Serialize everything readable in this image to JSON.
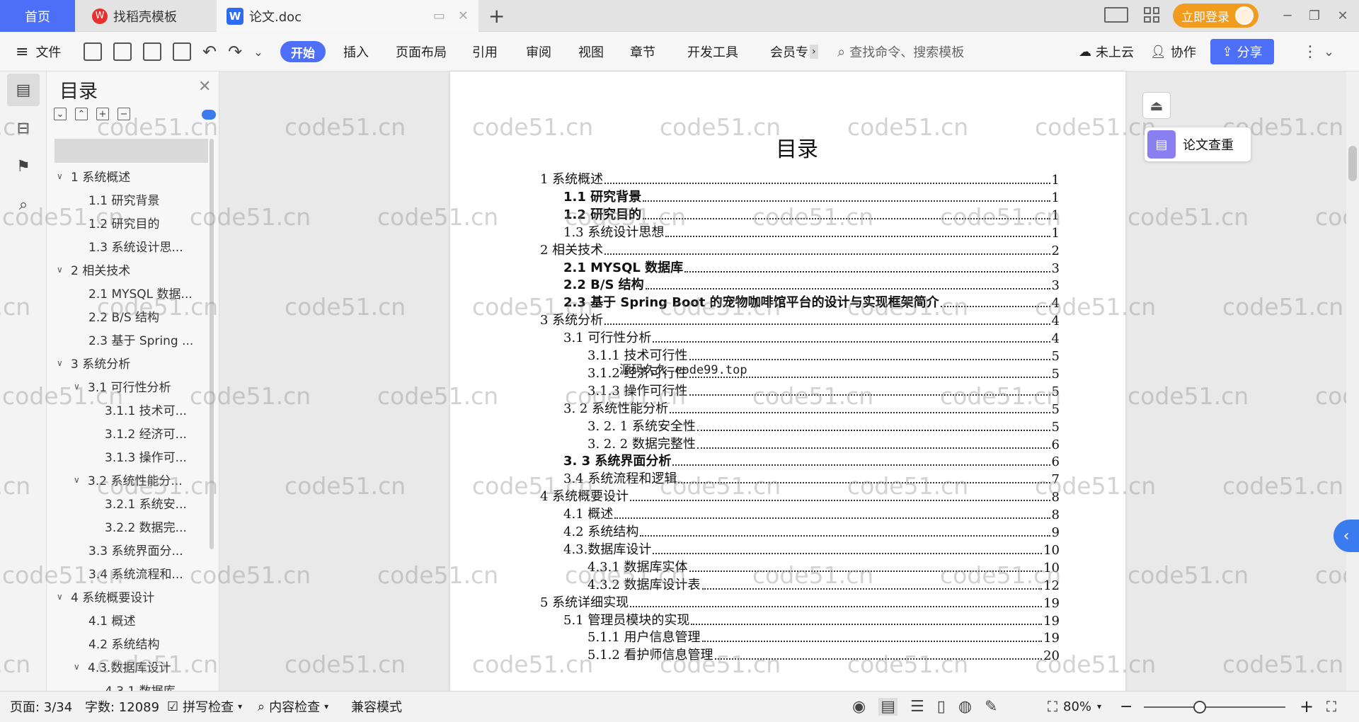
{
  "tabs": {
    "home": "首页",
    "template": "找稻壳模板",
    "doc": "论文.doc",
    "new_tab": "+"
  },
  "header": {
    "login": "立即登录"
  },
  "toolbar": {
    "file": "文件",
    "start": "开始",
    "items": [
      "插入",
      "页面布局",
      "引用",
      "审阅",
      "视图",
      "章节",
      "开发工具",
      "会员专"
    ],
    "search_placeholder": "查找命令、搜索模板",
    "cloud": "未上云",
    "collab": "协作",
    "share": "分享"
  },
  "toc_panel": {
    "title": "目录",
    "items": [
      {
        "label": "1 系统概述",
        "level": 1,
        "expand": true
      },
      {
        "label": "1.1 研究背景",
        "level": 2,
        "expand": false
      },
      {
        "label": "1.2 研究目的",
        "level": 2,
        "expand": false
      },
      {
        "label": "1.3 系统设计思...",
        "level": 2,
        "expand": false
      },
      {
        "label": "2 相关技术",
        "level": 1,
        "expand": true
      },
      {
        "label": "2.1 MYSQL 数据...",
        "level": 2,
        "expand": false
      },
      {
        "label": "2.2 B/S 结构",
        "level": 2,
        "expand": false
      },
      {
        "label": "2.3  基于 Spring ...",
        "level": 2,
        "expand": false
      },
      {
        "label": "3 系统分析",
        "level": 1,
        "expand": true
      },
      {
        "label": "3.1 可行性分析",
        "level": 2,
        "expand": true
      },
      {
        "label": "3.1.1 技术可...",
        "level": 3,
        "expand": false
      },
      {
        "label": "3.1.2 经济可...",
        "level": 3,
        "expand": false
      },
      {
        "label": "3.1.3 操作可...",
        "level": 3,
        "expand": false
      },
      {
        "label": "3.2 系统性能分...",
        "level": 2,
        "expand": true
      },
      {
        "label": "3.2.1  系统安...",
        "level": 3,
        "expand": false
      },
      {
        "label": "3.2.2  数据完...",
        "level": 3,
        "expand": false
      },
      {
        "label": "3.3 系统界面分...",
        "level": 2,
        "expand": false
      },
      {
        "label": "3.4 系统流程和...",
        "level": 2,
        "expand": false
      },
      {
        "label": "4 系统概要设计",
        "level": 1,
        "expand": true
      },
      {
        "label": "4.1 概述",
        "level": 2,
        "expand": false
      },
      {
        "label": "4.2 系统结构",
        "level": 2,
        "expand": false
      },
      {
        "label": "4.3.数据库设计",
        "level": 2,
        "expand": true
      },
      {
        "label": "4.3.1 数据库...",
        "level": 3,
        "expand": false
      }
    ]
  },
  "document": {
    "heading": "目录",
    "entries": [
      {
        "text": "1 系统概述",
        "page": "1",
        "indent": 0,
        "bold": false
      },
      {
        "text": "1.1  研究背景",
        "page": "1",
        "indent": 1,
        "bold": true
      },
      {
        "text": "1.2 研究目的",
        "page": "1",
        "indent": 1,
        "bold": true
      },
      {
        "text": "1.3 系统设计思想",
        "page": "1",
        "indent": 1,
        "bold": false
      },
      {
        "text": "2 相关技术",
        "page": "2",
        "indent": 0,
        "bold": false
      },
      {
        "text": "2.1 MYSQL 数据库",
        "page": "3",
        "indent": 1,
        "bold": true
      },
      {
        "text": "2.2 B/S 结构",
        "page": "3",
        "indent": 1,
        "bold": true
      },
      {
        "text": "2.3  基于 Spring Boot 的宠物咖啡馆平台的设计与实现框架简介",
        "page": "4",
        "indent": 1,
        "bold": true
      },
      {
        "text": "3 系统分析",
        "page": "4",
        "indent": 0,
        "bold": false
      },
      {
        "text": "3.1 可行性分析",
        "page": "4",
        "indent": 1,
        "bold": false
      },
      {
        "text": "3.1.1 技术可行性",
        "page": "5",
        "indent": 2,
        "bold": false
      },
      {
        "text": "3.1.2 经济可行性",
        "page": "5",
        "indent": 2,
        "bold": false
      },
      {
        "text": "3.1.3 操作可行性",
        "page": "5",
        "indent": 2,
        "bold": false
      },
      {
        "text": "3. 2 系统性能分析",
        "page": "5",
        "indent": 1,
        "bold": false
      },
      {
        "text": "3. 2. 1  系统安全性",
        "page": "5",
        "indent": 2,
        "bold": false
      },
      {
        "text": "3. 2. 2  数据完整性",
        "page": "6",
        "indent": 2,
        "bold": false
      },
      {
        "text": "3. 3 系统界面分析",
        "page": "6",
        "indent": 1,
        "bold": true
      },
      {
        "text": "3.4 系统流程和逻辑",
        "page": "7",
        "indent": 1,
        "bold": false
      },
      {
        "text": "4 系统概要设计",
        "page": "8",
        "indent": 0,
        "bold": false
      },
      {
        "text": "4.1 概述",
        "page": "8",
        "indent": 1,
        "bold": false
      },
      {
        "text": "4.2 系统结构",
        "page": "9",
        "indent": 1,
        "bold": false
      },
      {
        "text": "4.3.数据库设计",
        "page": "10",
        "indent": 1,
        "bold": false
      },
      {
        "text": "4.3.1  数据库实体",
        "page": "10",
        "indent": 2,
        "bold": false
      },
      {
        "text": "4.3.2 数据库设计表",
        "page": "12",
        "indent": 2,
        "bold": false
      },
      {
        "text": "5 系统详细实现",
        "page": "19",
        "indent": 0,
        "bold": false
      },
      {
        "text": "5.1  管理员模块的实现",
        "page": "19",
        "indent": 1,
        "bold": false
      },
      {
        "text": "5.1.1  用户信息管理",
        "page": "19",
        "indent": 2,
        "bold": false
      },
      {
        "text": "5.1.2  看护师信息管理",
        "page": "20",
        "indent": 2,
        "bold": false
      }
    ],
    "overlay": "源码久久 code99.top"
  },
  "watermark": "code51.cn",
  "right_panel": {
    "check": "论文查重"
  },
  "statusbar": {
    "page": "页面: 3/34",
    "words": "字数: 12089",
    "spell": "拼写检查",
    "content": "内容检查",
    "mode": "兼容模式",
    "zoom": "80%"
  },
  "colors": {
    "accent": "#4d6ef7",
    "login": "#f19b1f"
  }
}
